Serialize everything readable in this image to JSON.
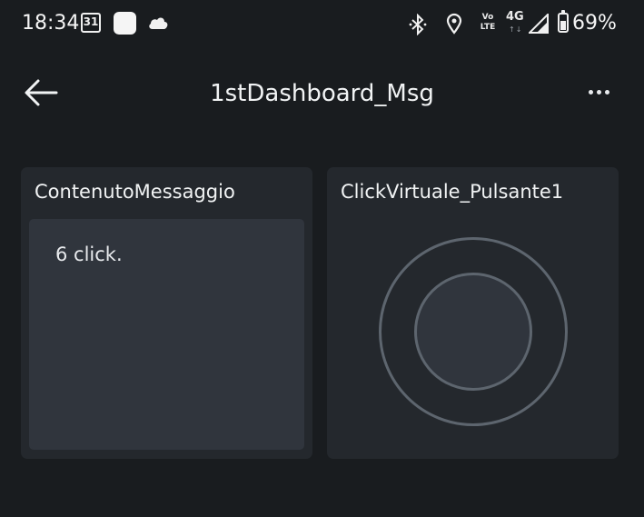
{
  "status_bar": {
    "time": "18:34",
    "calendar_day": "31",
    "volte_line1": "Vo",
    "volte_line2": "LTE",
    "network": "4G",
    "battery_percent": "69%",
    "battery_level": 0.69
  },
  "app_bar": {
    "title": "1stDashboard_Msg",
    "back_icon": "arrow-left-icon",
    "menu_icon": "more-horizontal-icon"
  },
  "widgets": [
    {
      "title": "ContenutoMessaggio",
      "message": "6 click."
    },
    {
      "title": "ClickVirtuale_Pulsante1"
    }
  ],
  "colors": {
    "background": "#191c1f",
    "card": "#24282d",
    "inner_panel": "#30353d",
    "ring": "#5d656e",
    "text": "#f1f3f4"
  }
}
